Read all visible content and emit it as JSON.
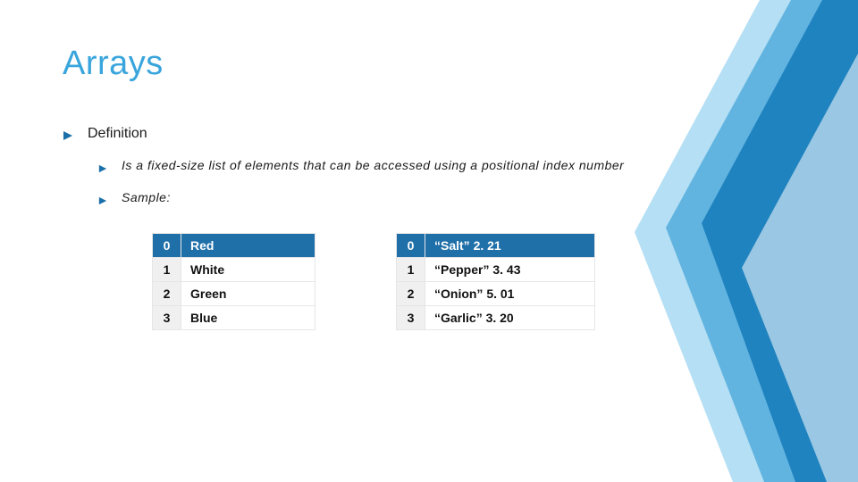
{
  "title": "Arrays",
  "bullets": {
    "definition_label": "Definition",
    "definition_body": "Is a fixed-size list of elements that can be accessed using a positional index number",
    "sample_label": "Sample:"
  },
  "table_colors": {
    "rows": [
      {
        "index": "0",
        "value": "Red"
      },
      {
        "index": "1",
        "value": "White"
      },
      {
        "index": "2",
        "value": "Green"
      },
      {
        "index": "3",
        "value": "Blue"
      }
    ]
  },
  "table_items": {
    "rows": [
      {
        "index": "0",
        "value": "“Salt” 2. 21"
      },
      {
        "index": "1",
        "value": "“Pepper” 3. 43"
      },
      {
        "index": "2",
        "value": "“Onion” 5. 01"
      },
      {
        "index": "3",
        "value": "“Garlic” 3. 20"
      }
    ]
  }
}
